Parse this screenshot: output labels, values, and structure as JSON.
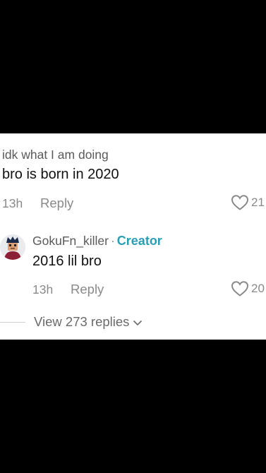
{
  "comment": {
    "username": "idk what I am doing",
    "text": "bro is born in 2020",
    "time": "13h",
    "reply_label": "Reply",
    "likes": "21",
    "like_icon": "heart-outline-icon"
  },
  "reply": {
    "username": "GokuFn_killer",
    "separator": "·",
    "badge": "Creator",
    "badge_color": "#2a9eb5",
    "text": "2016 lil bro",
    "time": "13h",
    "reply_label": "Reply",
    "likes": "20",
    "like_icon": "heart-outline-icon"
  },
  "view_replies": {
    "label": "View 273 replies",
    "icon": "chevron-down-icon"
  }
}
